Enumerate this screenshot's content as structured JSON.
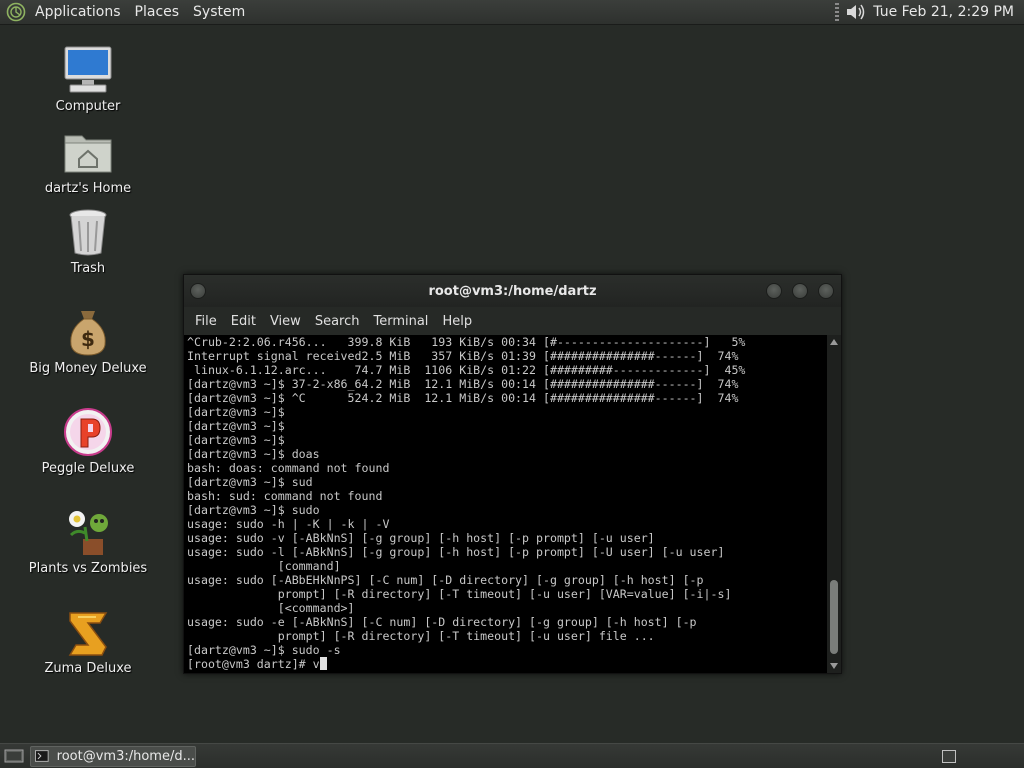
{
  "top_panel": {
    "menus": [
      "Applications",
      "Places",
      "System"
    ],
    "clock": "Tue Feb 21,  2:29 PM"
  },
  "desktop_icons": [
    {
      "label": "Computer",
      "icon": "computer-icon"
    },
    {
      "label": "dartz's Home",
      "icon": "home-folder-icon"
    },
    {
      "label": "Trash",
      "icon": "trash-icon"
    },
    {
      "label": "Big Money Deluxe",
      "icon": "money-bag-icon"
    },
    {
      "label": "Peggle Deluxe",
      "icon": "peggle-icon"
    },
    {
      "label": "Plants vs Zombies",
      "icon": "plants-vs-zombies-icon"
    },
    {
      "label": "Zuma Deluxe",
      "icon": "zuma-icon"
    }
  ],
  "terminal": {
    "title": "root@vm3:/home/dartz",
    "menus": [
      "File",
      "Edit",
      "View",
      "Search",
      "Terminal",
      "Help"
    ],
    "lines": [
      "^Crub-2:2.06.r456...   399.8 KiB   193 KiB/s 00:34 [#---------------------]   5%",
      "Interrupt signal received2.5 MiB   357 KiB/s 01:39 [###############------]  74%",
      " linux-6.1.12.arc...    74.7 MiB  1106 KiB/s 01:22 [#########-------------]  45%",
      "[dartz@vm3 ~]$ 37-2-x86_64.2 MiB  12.1 MiB/s 00:14 [###############------]  74%",
      "[dartz@vm3 ~]$ ^C      524.2 MiB  12.1 MiB/s 00:14 [###############------]  74%",
      "[dartz@vm3 ~]$",
      "[dartz@vm3 ~]$",
      "[dartz@vm3 ~]$",
      "[dartz@vm3 ~]$ doas",
      "bash: doas: command not found",
      "[dartz@vm3 ~]$ sud",
      "bash: sud: command not found",
      "[dartz@vm3 ~]$ sudo",
      "usage: sudo -h | -K | -k | -V",
      "usage: sudo -v [-ABkNnS] [-g group] [-h host] [-p prompt] [-u user]",
      "usage: sudo -l [-ABkNnS] [-g group] [-h host] [-p prompt] [-U user] [-u user]",
      "             [command]",
      "usage: sudo [-ABbEHkNnPS] [-C num] [-D directory] [-g group] [-h host] [-p",
      "             prompt] [-R directory] [-T timeout] [-u user] [VAR=value] [-i|-s]",
      "             [<command>]",
      "usage: sudo -e [-ABkNnS] [-C num] [-D directory] [-g group] [-h host] [-p",
      "             prompt] [-R directory] [-T timeout] [-u user] file ...",
      "[dartz@vm3 ~]$ sudo -s"
    ],
    "current_input": "[root@vm3 dartz]# v"
  },
  "bottom_panel": {
    "task_label": "root@vm3:/home/d..."
  }
}
